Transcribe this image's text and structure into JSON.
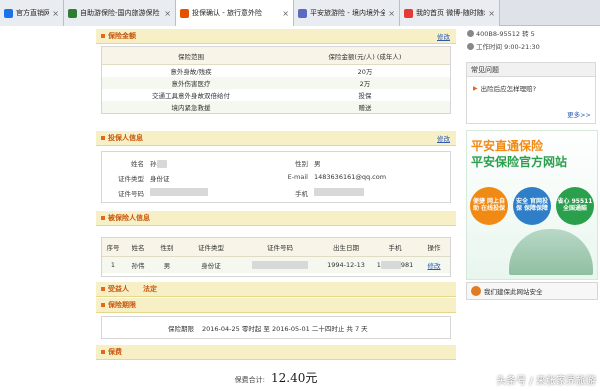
{
  "tabs": [
    {
      "label": "官方直销网站",
      "icon": "globe-icon",
      "color": "#1a73e8",
      "width": 64,
      "active": false
    },
    {
      "label": "自助游保险-国内旅游保险",
      "icon": "leaf-icon",
      "color": "#2e7d32",
      "width": 112,
      "active": false
    },
    {
      "label": "投保确认 - 旅行意外险",
      "icon": "shield-icon",
      "color": "#e65100",
      "width": 118,
      "active": true
    },
    {
      "label": "平安旅游险 - 境内境外全",
      "icon": "page-icon",
      "color": "#5c6bc0",
      "width": 106,
      "active": false
    },
    {
      "label": "我的首页 微博-随时随地",
      "icon": "weibo-icon",
      "color": "#e53935",
      "width": 100,
      "active": false
    }
  ],
  "sections": {
    "coverage": {
      "title": "保险金额",
      "edit": "修改"
    },
    "applicant": {
      "title": "投保人信息",
      "edit": "修改"
    },
    "insured": {
      "title": "被保险人信息"
    },
    "beneficiary": {
      "title": "受益人",
      "value": "法定"
    },
    "period": {
      "title": "保险期限"
    },
    "premium": {
      "title": "保费"
    }
  },
  "coverage": {
    "head": [
      "保险范围",
      "保险金额(元/人) (成年人)"
    ],
    "rows": [
      [
        "意外身故/残疾",
        "20万"
      ],
      [
        "意外伤害医疗",
        "2万"
      ],
      [
        "交通工具意外身故双倍给付",
        "投保"
      ],
      [
        "境内紧急救援",
        "赠送"
      ]
    ]
  },
  "applicant": {
    "name_label": "姓名",
    "name_value": "孙",
    "id_type_label": "证件类型",
    "id_type_value": "身份证",
    "id_no_label": "证件号码",
    "gender_label": "性别",
    "gender_value": "男",
    "email_label": "E-mail",
    "email_value": "1483636161@qq.com",
    "phone_label": "手机"
  },
  "insured": {
    "head": [
      "序号",
      "姓名",
      "性别",
      "证件类型",
      "证件号码",
      "出生日期",
      "手机",
      "操作"
    ],
    "row": [
      "1",
      "孙伟",
      "男",
      "身份证",
      "",
      "1994-12-13",
      "1",
      "修改"
    ],
    "phone_tail": "981"
  },
  "period": {
    "label": "保险期限",
    "value": "2016-04-25 零时起 至 2016-05-01 二十四时止 共 7 天"
  },
  "premium": {
    "label": "保费合计:",
    "amount": "12.40元"
  },
  "sidebar": {
    "phone": "400B8-95512 转 5",
    "hours": "工作时间 9:00-21:30",
    "faq_title": "常见问题",
    "faq_item": "出险后应怎样理赔?",
    "more": "更多>>",
    "ad_line1": "平安直通保险",
    "ad_line2": "平安保险官方网站",
    "badges": [
      {
        "text": "便捷 网上自助 在线投保",
        "color": "#f08a14"
      },
      {
        "text": "安全 官网投保 保障保障",
        "color": "#2f7fc8"
      },
      {
        "text": "省心 95511 全国通赔",
        "color": "#2aa04c"
      }
    ],
    "download": "我们建保此网站安全"
  },
  "watermark": "头条号 / 来张家界旅游"
}
